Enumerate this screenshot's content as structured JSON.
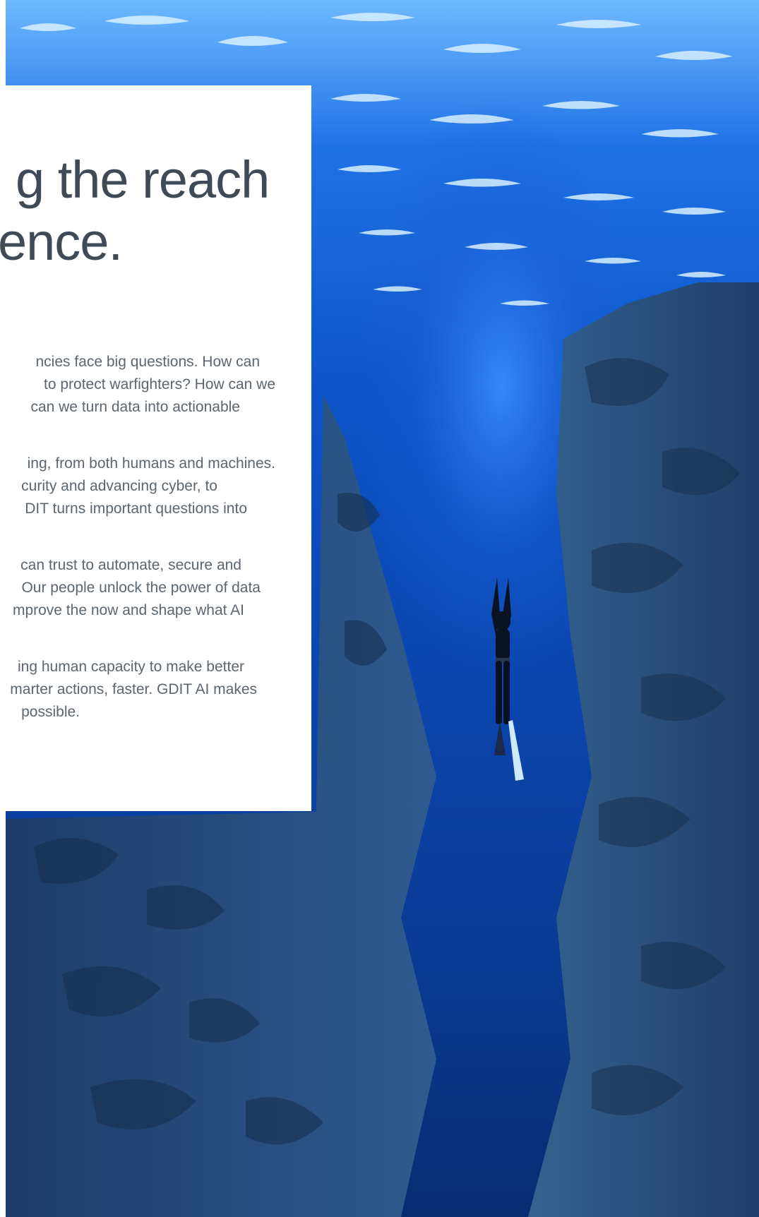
{
  "headline": {
    "line1": "g the reach",
    "line2": "ence."
  },
  "paragraphs": [
    {
      "lines": [
        "ncies face big questions. How can",
        "to protect warfighters? How can we",
        "can we turn data into actionable"
      ]
    },
    {
      "lines": [
        "ing, from both humans and machines.",
        "curity and advancing cyber, to",
        "DIT turns important questions into"
      ]
    },
    {
      "lines": [
        "can trust to automate, secure and",
        "Our people unlock the power of data",
        "mprove the now and shape what AI"
      ]
    },
    {
      "lines": [
        "ing human capacity to make better",
        "marter actions, faster. GDIT AI makes",
        "possible."
      ]
    }
  ],
  "hero": {
    "subject": "freediver-in-underwater-canyon",
    "colors": {
      "surface_light": "#bfe7ff",
      "water_mid": "#1b63d8",
      "water_deep": "#07307e",
      "rock": "#2b4c7a",
      "rock_dark": "#14294a"
    }
  }
}
